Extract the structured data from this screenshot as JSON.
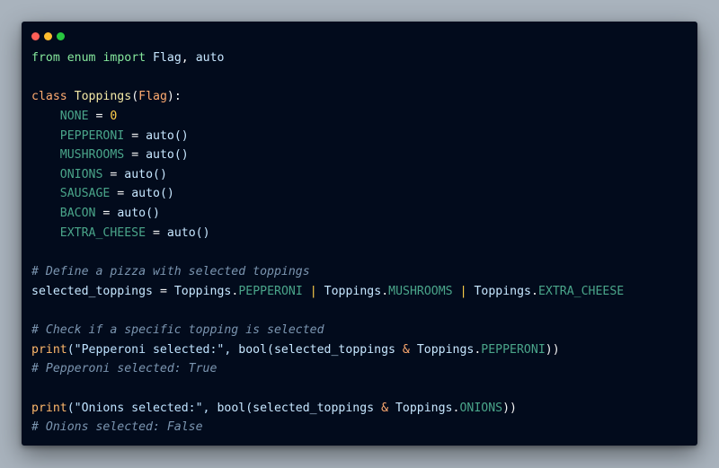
{
  "window": {
    "traffic_lights": {
      "close_color": "#ff5f57",
      "minimize_color": "#febc2e",
      "maximize_color": "#28c840"
    }
  },
  "code": {
    "line1": {
      "t1": "from",
      "t2": "enum",
      "t3": "import",
      "t4": "Flag",
      "t5": ",",
      "t6": "auto"
    },
    "line3": {
      "t1": "class",
      "t2": "Toppings",
      "t3": "(",
      "t4": "Flag",
      "t5": "):"
    },
    "members": [
      {
        "name": "NONE",
        "value": "0"
      },
      {
        "name": "PEPPERONI",
        "value": "auto()"
      },
      {
        "name": "MUSHROOMS",
        "value": "auto()"
      },
      {
        "name": "ONIONS",
        "value": "auto()"
      },
      {
        "name": "SAUSAGE",
        "value": "auto()"
      },
      {
        "name": "BACON",
        "value": "auto()"
      },
      {
        "name": "EXTRA_CHEESE",
        "value": "auto()"
      }
    ],
    "comment1": "# Define a pizza with selected toppings",
    "selected": {
      "var": "selected_toppings",
      "eq": "=",
      "c1": "Toppings",
      "a1": "PEPPERONI",
      "pipe1": "|",
      "c2": "Toppings",
      "a2": "MUSHROOMS",
      "pipe2": "|",
      "c3": "Toppings",
      "a3": "EXTRA_CHEESE"
    },
    "comment2": "# Check if a specific topping is selected",
    "print1": {
      "fn": "print",
      "str": "(\"Pepperoni selected:\",",
      "call": "bool(selected_toppings",
      "amp": "&",
      "cls": "Toppings",
      "attr": "PEPPERONI",
      "end": "))"
    },
    "comment3": "# Pepperoni selected: True",
    "print2": {
      "fn": "print",
      "str": "(\"Onions selected:\",",
      "call": "bool(selected_toppings",
      "amp": "&",
      "cls": "Toppings",
      "attr": "ONIONS",
      "end": "))"
    },
    "comment4": "# Onions selected: False"
  }
}
